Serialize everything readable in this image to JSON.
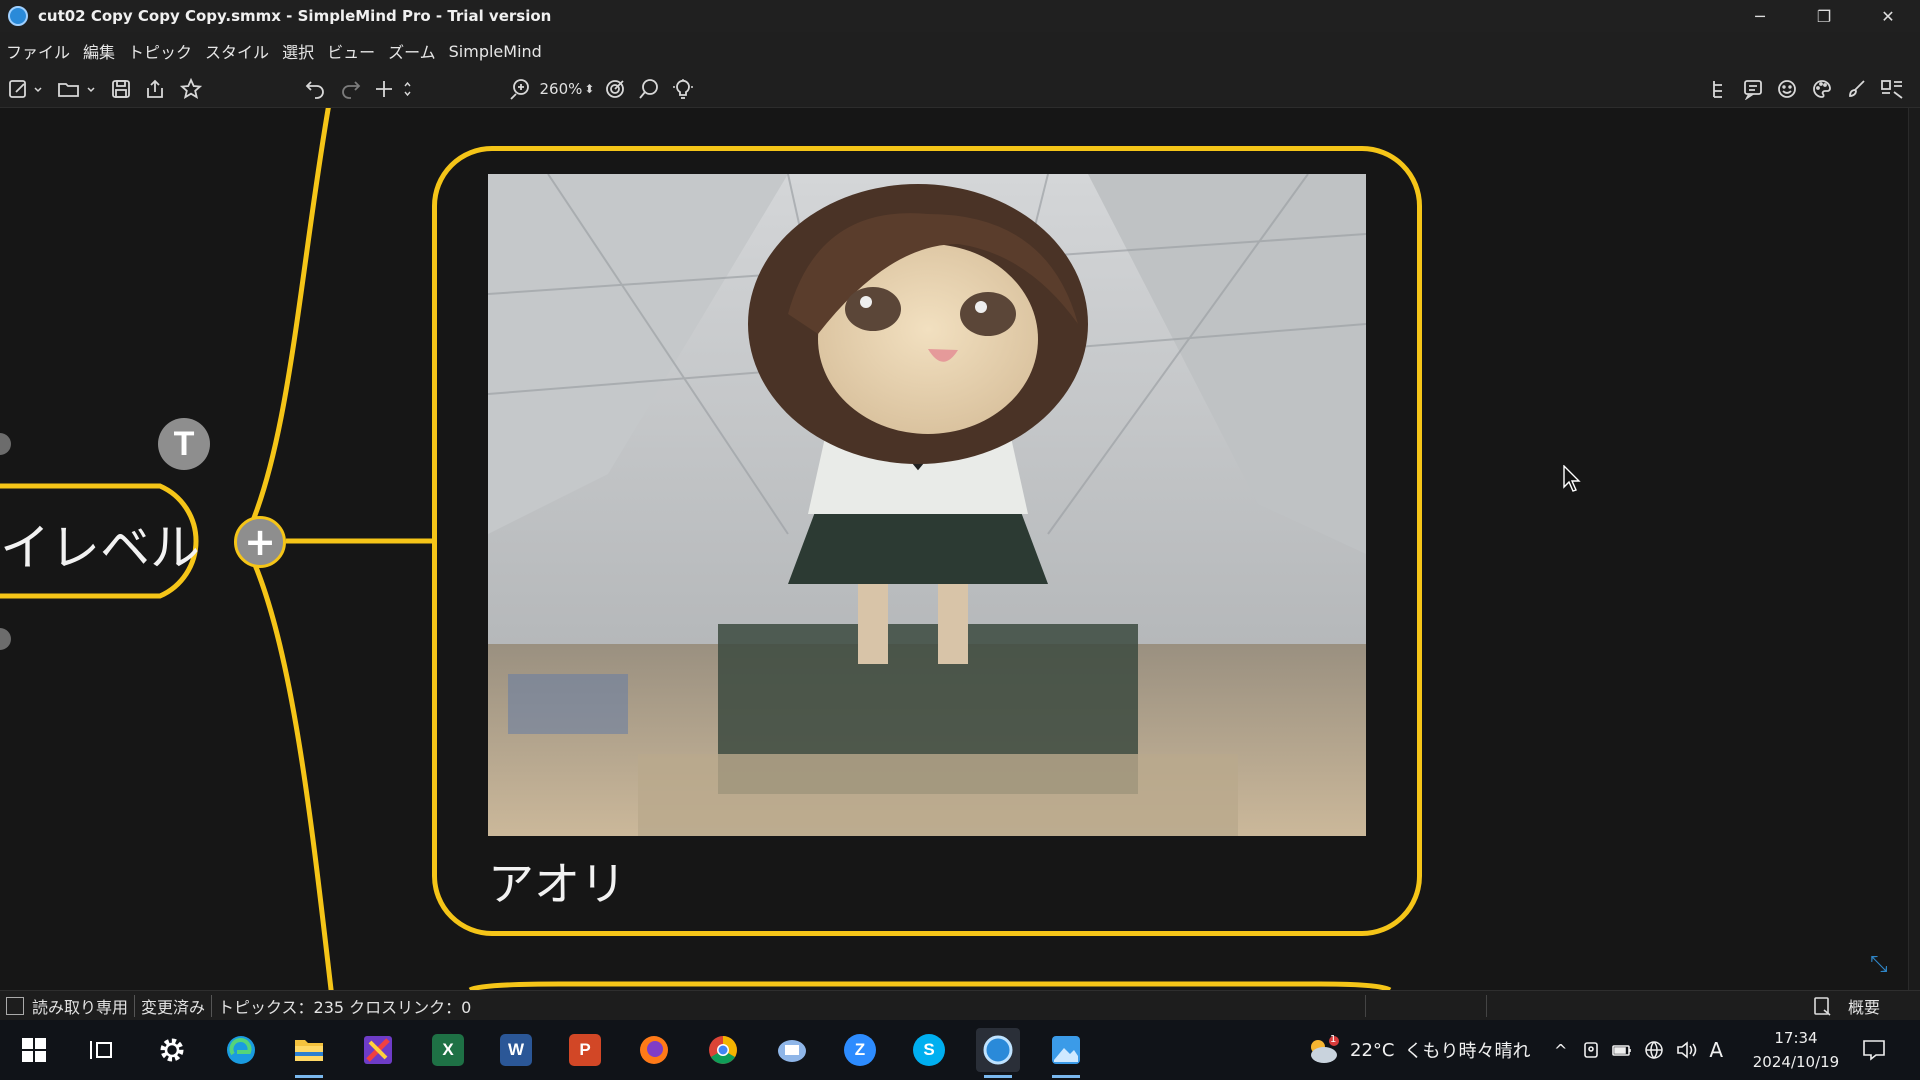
{
  "window": {
    "title": "cut02 Copy Copy Copy.smmx - SimpleMind Pro - Trial version",
    "minimize_icon": "─",
    "restore_icon": "❐",
    "close_icon": "✕"
  },
  "menu": [
    "ファイル",
    "編集",
    "トピック",
    "スタイル",
    "選択",
    "ビュー",
    "ズーム",
    "SimpleMind"
  ],
  "toolbar": {
    "zoom_level": "260%",
    "zoom_spinner": "⬍"
  },
  "canvas": {
    "parent_topic_label": "イレベル",
    "text_badge": "T",
    "add_badge": "+",
    "image_topic_label": "アオリ",
    "branch_color": "#f5c518"
  },
  "statusbar": {
    "read_only": "読み取り専用",
    "modified": "変更済み",
    "stats": "トピックス：235 クロスリンク：0",
    "outline": "概要"
  },
  "taskbar": {
    "weather_temp": "22°C",
    "weather_text": "くもり時々晴れ",
    "weather_badge": "1",
    "ime": "A",
    "time": "17:34",
    "date": "2024/10/19",
    "tray_chevron": "^",
    "apps": {
      "excel": "X",
      "word": "W",
      "powerpoint": "P",
      "zoom": "Z",
      "skype": "S"
    }
  }
}
